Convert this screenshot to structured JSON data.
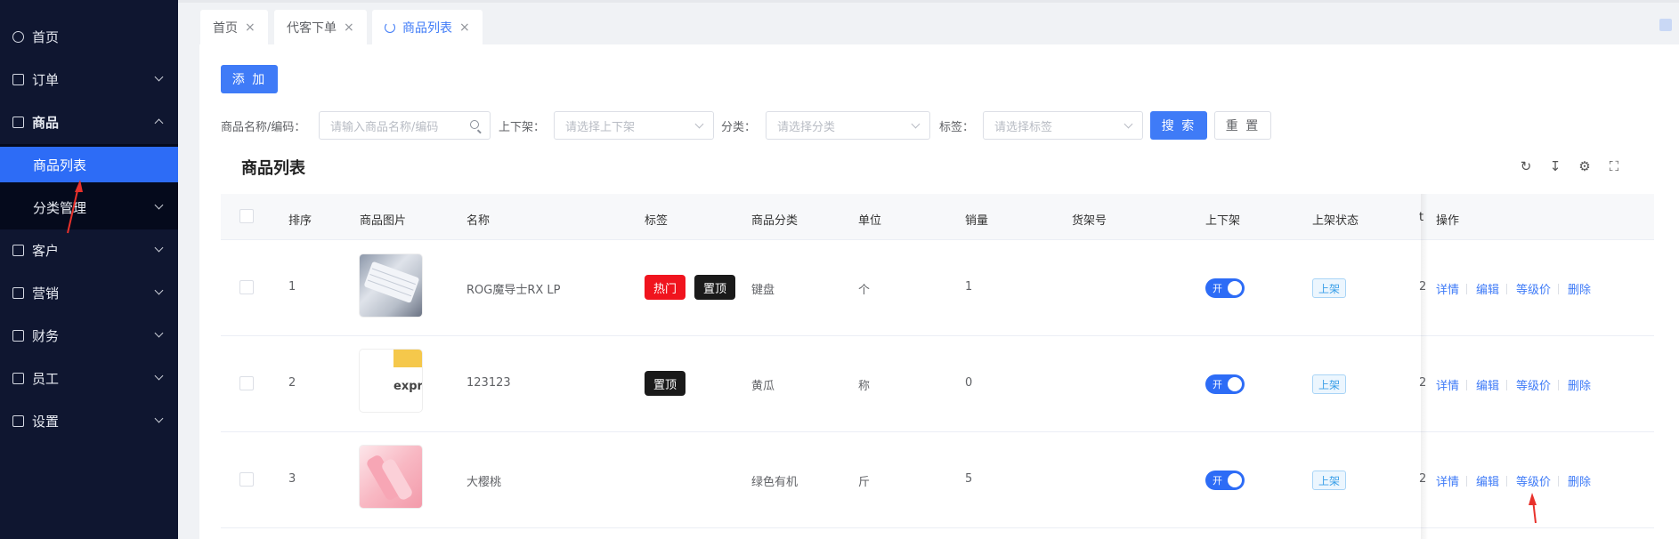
{
  "sidebar": {
    "items": [
      {
        "label": "首页"
      },
      {
        "label": "订单"
      },
      {
        "label": "商品"
      },
      {
        "label": "客户"
      },
      {
        "label": "营销"
      },
      {
        "label": "财务"
      },
      {
        "label": "员工"
      },
      {
        "label": "设置"
      }
    ],
    "sub_items": [
      {
        "label": "商品列表"
      },
      {
        "label": "分类管理"
      }
    ]
  },
  "tabs": [
    {
      "label": "首页",
      "close": "×"
    },
    {
      "label": "代客下单",
      "close": "×"
    },
    {
      "label": "商品列表",
      "close": "×"
    }
  ],
  "toolbar": {
    "add_label": "添 加"
  },
  "filters": {
    "name_label": "商品名称/编码：",
    "name_placeholder": "请输入商品名称/编码",
    "shelf_label": "上下架：",
    "shelf_placeholder": "请选择上下架",
    "category_label": "分类：",
    "category_placeholder": "请选择分类",
    "tag_label": "标签：",
    "tag_placeholder": "请选择标签",
    "search_label": "搜 索",
    "reset_label": "重 置"
  },
  "list": {
    "title": "商品列表",
    "columns": [
      "排序",
      "商品图片",
      "名称",
      "标签",
      "商品分类",
      "单位",
      "销量",
      "货架号",
      "上下架",
      "上架状态",
      "t",
      "操作"
    ],
    "rows": [
      {
        "order": "1",
        "name": "ROG魔导士RX LP",
        "tags": [
          "热门",
          "置顶"
        ],
        "category": "键盘",
        "unit": "个",
        "sales": "1",
        "toggle": "开",
        "status": "上架",
        "partial": "2",
        "thumb_text": ""
      },
      {
        "order": "2",
        "name": "123123",
        "tags": [
          "置顶"
        ],
        "category": "黄瓜",
        "unit": "称",
        "sales": "0",
        "toggle": "开",
        "status": "上架",
        "partial": "2",
        "thumb_text": "expr"
      },
      {
        "order": "3",
        "name": "大樱桃",
        "tags": [],
        "category": "绿色有机",
        "unit": "斤",
        "sales": "5",
        "toggle": "开",
        "status": "上架",
        "partial": "2",
        "thumb_text": ""
      }
    ],
    "actions": [
      "详情",
      "编辑",
      "等级价",
      "删除"
    ]
  },
  "colors": {
    "sidebar_bg": "#0f1630",
    "accent": "#2d6cf6",
    "tag_hot": "#f0141e",
    "tag_top": "#1a1a1a",
    "arrow": "#e8312b"
  }
}
